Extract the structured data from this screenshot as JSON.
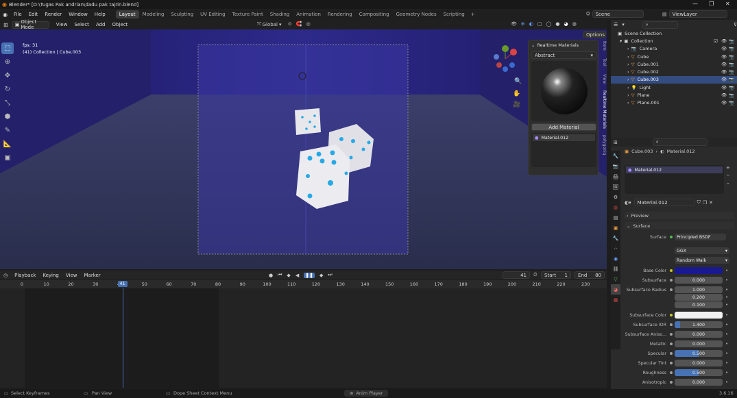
{
  "window": {
    "title": "Blender* [D:\\Tugas Pak andrian\\dadu pak tajrin.blend]"
  },
  "menu": [
    "File",
    "Edit",
    "Render",
    "Window",
    "Help"
  ],
  "workspaces": [
    "Layout",
    "Modeling",
    "Sculpting",
    "UV Editing",
    "Texture Paint",
    "Shading",
    "Animation",
    "Rendering",
    "Compositing",
    "Geometry Nodes",
    "Scripting"
  ],
  "active_workspace": "Layout",
  "scene": {
    "name": "Scene",
    "view_layer": "ViewLayer"
  },
  "viewport": {
    "mode": "Object Mode",
    "menus": [
      "View",
      "Select",
      "Add",
      "Object"
    ],
    "transform_orientation": "Global",
    "options_label": "Options",
    "fps": "fps: 31",
    "collection_info": "(41) Collection | Cube.003"
  },
  "npanel": {
    "title": "Realtime Materials",
    "preset": "Abstract",
    "add_button": "Add Material",
    "material": "Material.012",
    "tabs": [
      "Item",
      "Tool",
      "View",
      "Realtime Materials",
      "polygoniq"
    ]
  },
  "timeline": {
    "menus": [
      "Playback",
      "Keying",
      "View",
      "Marker"
    ],
    "current_frame": "41",
    "start_label": "Start",
    "start": "1",
    "end_label": "End",
    "end": "80",
    "ticks": [
      "0",
      "10",
      "20",
      "30",
      "40",
      "50",
      "60",
      "70",
      "80",
      "90",
      "100",
      "110",
      "120",
      "130",
      "140",
      "150",
      "160",
      "170",
      "180",
      "190",
      "200",
      "210",
      "220",
      "230"
    ],
    "frame_values": [
      0,
      10,
      20,
      30,
      40,
      50,
      60,
      70,
      80,
      90,
      100,
      110,
      120,
      130,
      140,
      150,
      160,
      170,
      180,
      190,
      200,
      210,
      220,
      230
    ],
    "playhead": 41
  },
  "outliner": {
    "root": "Scene Collection",
    "collection": "Collection",
    "items": [
      {
        "name": "Camera",
        "icon": "camera-icon",
        "selected": false
      },
      {
        "name": "Cube",
        "icon": "mesh-icon",
        "selected": false
      },
      {
        "name": "Cube.001",
        "icon": "mesh-icon",
        "selected": false
      },
      {
        "name": "Cube.002",
        "icon": "mesh-icon",
        "selected": false
      },
      {
        "name": "Cube.003",
        "icon": "mesh-icon",
        "selected": true
      },
      {
        "name": "Light",
        "icon": "light-icon",
        "selected": false
      },
      {
        "name": "Plane",
        "icon": "mesh-icon",
        "selected": false
      },
      {
        "name": "Plane.001",
        "icon": "mesh-icon",
        "selected": false
      }
    ]
  },
  "properties": {
    "breadcrumb_object": "Cube.003",
    "breadcrumb_material": "Material.012",
    "slot": "Material.012",
    "material_name": "Material.012",
    "preview_label": "Preview",
    "surface_label": "Surface",
    "surface_field_label": "Surface",
    "surface_shader": "Principled BSDF",
    "distribution": "GGX",
    "subsurface_method": "Random Walk",
    "fields": [
      {
        "label": "Base Color",
        "value": "",
        "color": "#1a1a90",
        "kind": "color"
      },
      {
        "label": "Subsurface",
        "value": "0.000",
        "kind": "number"
      },
      {
        "label": "Subsurface Radius",
        "value": "1.000",
        "kind": "number"
      },
      {
        "label": "",
        "value": "0.200",
        "kind": "number"
      },
      {
        "label": "",
        "value": "0.100",
        "kind": "number"
      },
      {
        "label": "Subsurface Color",
        "value": "",
        "color": "#f2f2f2",
        "kind": "color"
      },
      {
        "label": "Subsurface IOR",
        "value": "1.400",
        "kind": "slider",
        "fraction": 0.12
      },
      {
        "label": "Subsurface Aniso...",
        "value": "0.000",
        "kind": "number"
      },
      {
        "label": "Metallic",
        "value": "0.000",
        "kind": "number"
      },
      {
        "label": "Specular",
        "value": "0.500",
        "kind": "slider",
        "fraction": 0.5
      },
      {
        "label": "Specular Tint",
        "value": "0.000",
        "kind": "number"
      },
      {
        "label": "Roughness",
        "value": "0.500",
        "kind": "slider",
        "fraction": 0.5
      },
      {
        "label": "Anisotropic",
        "value": "0.000",
        "kind": "number"
      }
    ]
  },
  "status": {
    "left1": "Select Keyframes",
    "left2": "Pan View",
    "left3": "Dope Sheet Context Menu",
    "center": "Anim Player",
    "version": "3.6.16"
  },
  "colors": {
    "accent": "#4772b3",
    "selected_row": "#334d80",
    "viewport_bg": "#2a2555"
  }
}
